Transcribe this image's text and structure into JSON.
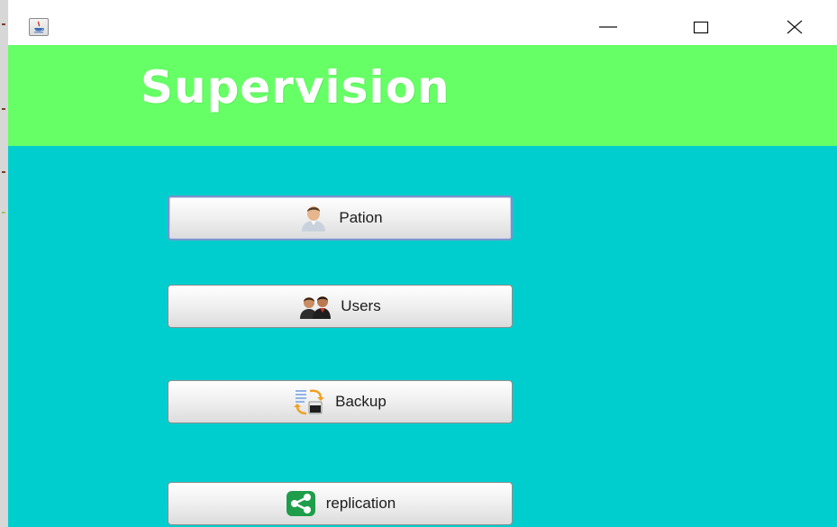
{
  "window": {
    "title_icon": "java-cup-icon",
    "controls": {
      "minimize": "minimize-icon",
      "maximize": "maximize-icon",
      "close": "close-icon"
    }
  },
  "header": {
    "title": "Supervision",
    "background": "#66ff66"
  },
  "main": {
    "background": "#00cece",
    "buttons": [
      {
        "label": "Pation",
        "icon": "patient-person-icon",
        "focused": true
      },
      {
        "label": "Users",
        "icon": "users-group-icon",
        "focused": false
      },
      {
        "label": "Backup",
        "icon": "backup-sync-icon",
        "focused": false
      },
      {
        "label": "replication",
        "icon": "share-icon",
        "focused": false
      }
    ]
  }
}
